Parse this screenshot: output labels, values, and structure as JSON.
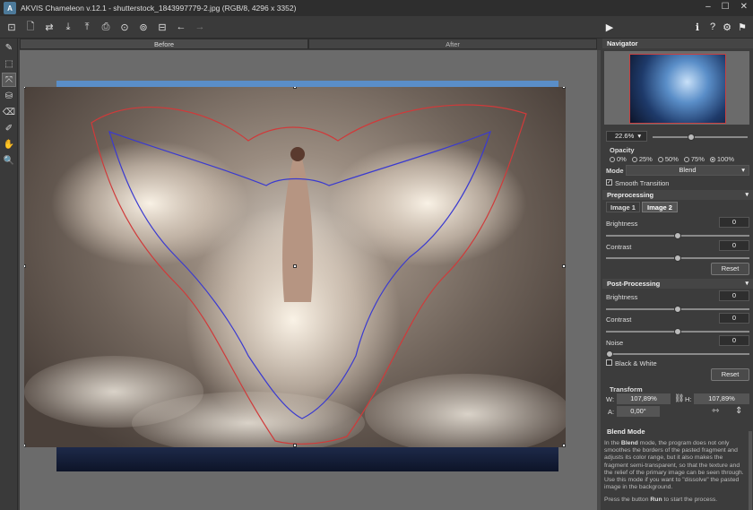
{
  "titlebar": {
    "title": "AKVIS Chameleon v.12.1 - shutterstock_1843997779-2.jpg (RGB/8, 4296 x 3352)",
    "logo": "A",
    "minimize": "–",
    "maximize": "☐",
    "close": "✕"
  },
  "toolbar": {
    "icons": [
      "open-project-icon",
      "open-image-icon",
      "swap-icon",
      "save-icon",
      "export-icon",
      "print-icon",
      "share-icon",
      "batch-icon",
      "grid-icon",
      "undo-icon",
      "redo-icon"
    ],
    "glyphs": [
      "⊡",
      "🗋",
      "⇄",
      "⤓",
      "⤒",
      "⎙",
      "⊙",
      "⊚",
      "⊟",
      "←",
      "→"
    ],
    "run_glyph": "▶",
    "info_glyph": "ℹ",
    "help_glyph": "?",
    "settings_glyph": "⚙",
    "feedback_glyph": "⚑"
  },
  "tools": {
    "glyphs": [
      "✎",
      "⬚",
      "⤧",
      "⛁",
      "⌫",
      "✐",
      "✋",
      "🔍"
    ]
  },
  "tabs": {
    "before": "Before",
    "after": "After"
  },
  "navigator": {
    "title": "Navigator"
  },
  "zoom": {
    "value": "22.6%",
    "arrow": "▾",
    "level": 0.4
  },
  "opacity": {
    "title": "Opacity",
    "options": [
      "0%",
      "25%",
      "50%",
      "75%",
      "100%"
    ],
    "selected": "100%"
  },
  "mode": {
    "label": "Mode",
    "value": "Blend",
    "arrow": "▾"
  },
  "smooth_transition": {
    "label": "Smooth Transition",
    "checked": true,
    "mark": "✓"
  },
  "preprocessing": {
    "title": "Preprocessing",
    "arrow": "▾",
    "tab1": "Image 1",
    "tab2": "Image 2",
    "brightness_label": "Brightness",
    "brightness_value": "0",
    "contrast_label": "Contrast",
    "contrast_value": "0",
    "reset": "Reset"
  },
  "postprocessing": {
    "title": "Post-Processing",
    "arrow": "▾",
    "brightness_label": "Brightness",
    "brightness_value": "0",
    "contrast_label": "Contrast",
    "contrast_value": "0",
    "noise_label": "Noise",
    "noise_value": "0",
    "bw_label": "Black & White",
    "reset": "Reset"
  },
  "transform": {
    "title": "Transform",
    "w_label": "W:",
    "w_value": "107,89%",
    "h_label": "H:",
    "h_value": "107,89%",
    "a_label": "A:",
    "a_value": "0,00°",
    "link_glyph": "⛓",
    "flip_h_glyph": "⇿",
    "flip_v_glyph": "⇕"
  },
  "help": {
    "title": "Blend Mode",
    "p1_pre": "In the ",
    "p1_bold": "Blend",
    "p1_post": " mode, the program does not only smoothes the borders of the pasted fragment and adjusts its color range, but it also makes the fragment semi-transparent, so that the texture and the relief of the primary image can be seen through. Use this mode if you want to \"dissolve\" the pasted image in the background.",
    "p2_pre": "Press the button ",
    "p2_bold": "Run",
    "p2_post": " to start the process."
  }
}
